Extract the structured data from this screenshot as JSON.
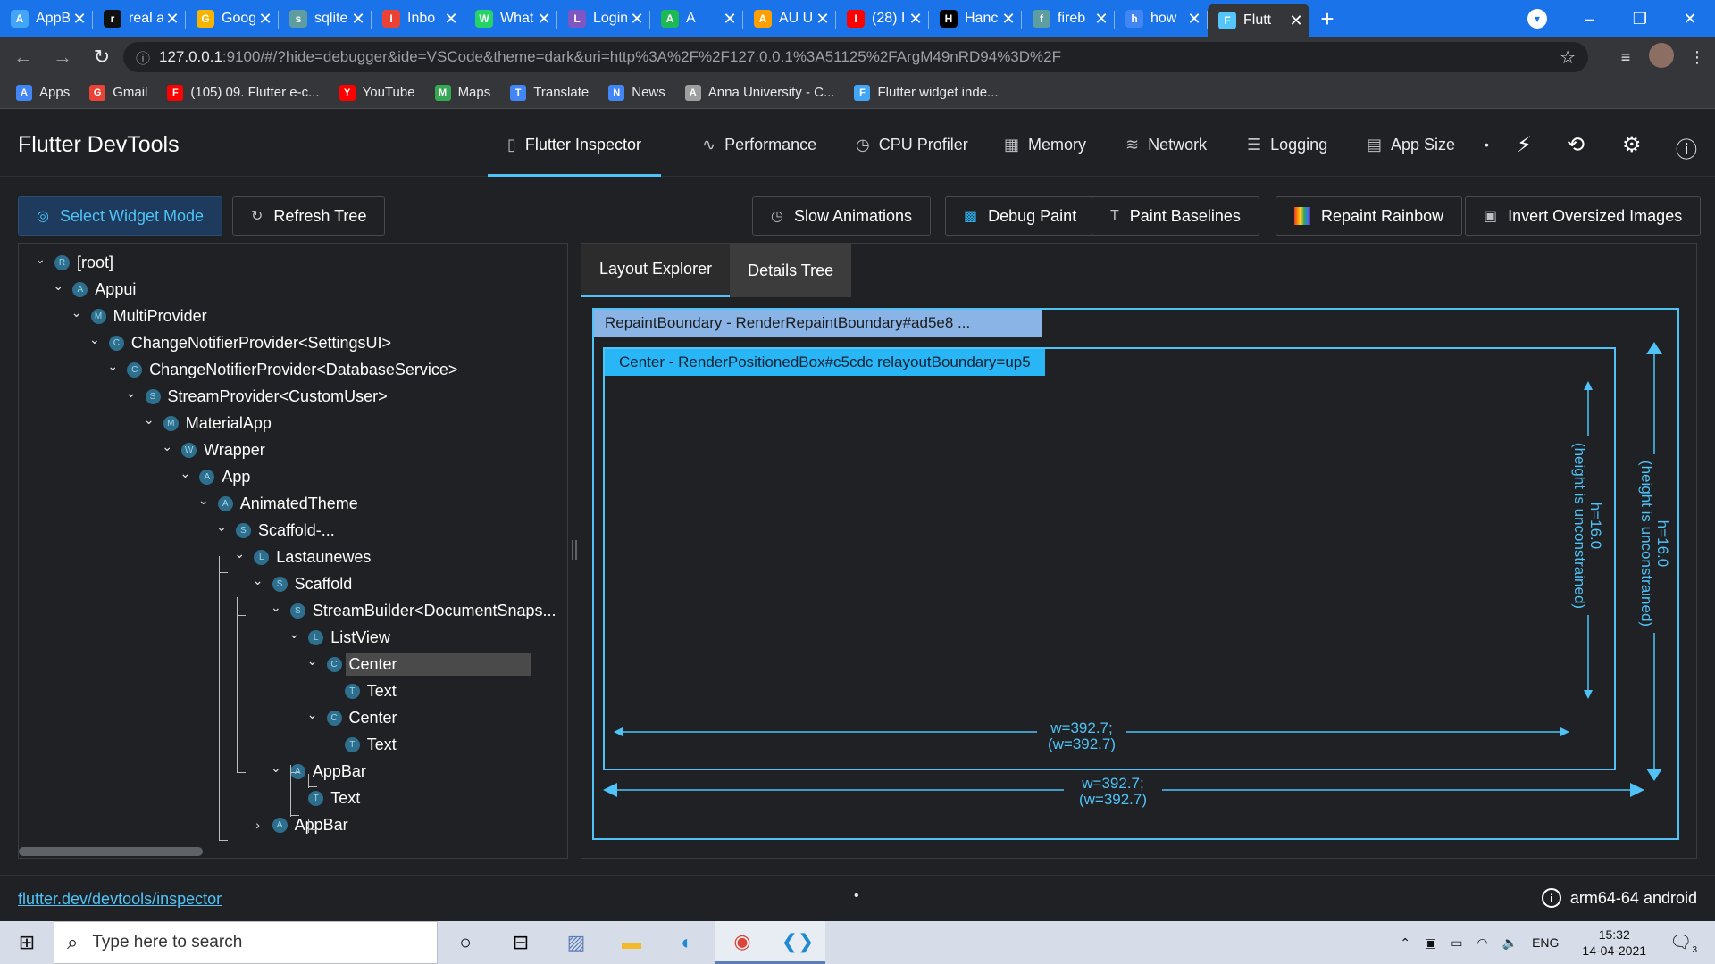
{
  "browser": {
    "tabs": [
      {
        "title": "AppB",
        "icon": "flutter-icon",
        "color": "#42a5f5"
      },
      {
        "title": "real a",
        "icon": "github-icon",
        "color": "#111111"
      },
      {
        "title": "Goog",
        "icon": "drive-icon",
        "color": "#f4b400"
      },
      {
        "title": "sqlite",
        "icon": "sqlite-icon",
        "color": "#5f9ea0"
      },
      {
        "title": "Inbo",
        "icon": "gmail-icon",
        "color": "#ea4335"
      },
      {
        "title": "What",
        "icon": "whatsapp-icon",
        "color": "#25d366"
      },
      {
        "title": "Login",
        "icon": "login-icon",
        "color": "#7e57c2"
      },
      {
        "title": "A",
        "icon": "spotify-icon",
        "color": "#1db954"
      },
      {
        "title": "AU U",
        "icon": "firebase-icon",
        "color": "#ffa000"
      },
      {
        "title": "(28) I",
        "icon": "youtube-icon",
        "color": "#ff0000"
      },
      {
        "title": "Hanc",
        "icon": "notion-icon",
        "color": "#000000"
      },
      {
        "title": "fireb",
        "icon": "firebase-docs-icon",
        "color": "#5f9ea0"
      },
      {
        "title": "how",
        "icon": "google-icon",
        "color": "#4285f4"
      },
      {
        "title": "Flutt",
        "icon": "flutter-devtools-icon",
        "color": "#54c5f8",
        "active": true
      }
    ],
    "url": {
      "host": "127.0.0.1",
      "rest": ":9100/#/?hide=debugger&ide=VSCode&theme=dark&uri=http%3A%2F%2F127.0.0.1%3A51125%2FArgM49nRD94%3D%2F"
    },
    "bookmarks": [
      {
        "label": "Apps",
        "icon": "apps-grid-icon",
        "color": "#4285f4"
      },
      {
        "label": "Gmail",
        "icon": "gmail-icon",
        "color": "#ea4335"
      },
      {
        "label": "(105) 09. Flutter e-c...",
        "icon": "youtube-icon",
        "color": "#ff0000"
      },
      {
        "label": "YouTube",
        "icon": "youtube-icon",
        "color": "#ff0000"
      },
      {
        "label": "Maps",
        "icon": "maps-icon",
        "color": "#34a853"
      },
      {
        "label": "Translate",
        "icon": "translate-icon",
        "color": "#4285f4"
      },
      {
        "label": "News",
        "icon": "news-icon",
        "color": "#4285f4"
      },
      {
        "label": "Anna University - C...",
        "icon": "university-icon",
        "color": "#9e9e9e"
      },
      {
        "label": "Flutter widget inde...",
        "icon": "flutter-icon",
        "color": "#42a5f5"
      }
    ]
  },
  "devtools": {
    "title": "Flutter DevTools",
    "nav": [
      {
        "label": "Flutter Inspector",
        "icon": "phone-icon",
        "active": true
      },
      {
        "label": "Performance",
        "icon": "pulse-icon"
      },
      {
        "label": "CPU Profiler",
        "icon": "timer-icon"
      },
      {
        "label": "Memory",
        "icon": "memory-icon"
      },
      {
        "label": "Network",
        "icon": "network-icon"
      },
      {
        "label": "Logging",
        "icon": "logging-icon"
      },
      {
        "label": "App Size",
        "icon": "app-size-icon"
      }
    ],
    "header_icons": [
      "lightning-icon",
      "hot-restart-icon",
      "settings-icon",
      "help-icon"
    ],
    "actions_left": [
      {
        "label": "Select Widget Mode",
        "icon": "target-icon",
        "selected": true
      },
      {
        "label": "Refresh Tree",
        "icon": "refresh-icon"
      }
    ],
    "actions_right": [
      {
        "label": "Slow Animations",
        "icon": "clock-icon"
      },
      {
        "label": "Debug Paint",
        "icon": "debug-paint-icon"
      },
      {
        "label": "Paint Baselines",
        "icon": "text-baseline-icon"
      },
      {
        "label": "Repaint Rainbow",
        "icon": "rainbow-icon"
      },
      {
        "label": "Invert Oversized Images",
        "icon": "image-icon"
      }
    ],
    "tree": [
      {
        "label": "[root]",
        "badge": "R",
        "depth": 0,
        "chevron": "down"
      },
      {
        "label": "Appui",
        "badge": "A",
        "depth": 1,
        "chevron": "down"
      },
      {
        "label": "MultiProvider",
        "badge": "M",
        "depth": 2,
        "chevron": "down"
      },
      {
        "label": "ChangeNotifierProvider<SettingsUI>",
        "badge": "C",
        "depth": 3,
        "chevron": "down"
      },
      {
        "label": "ChangeNotifierProvider<DatabaseService>",
        "badge": "C",
        "depth": 4,
        "chevron": "down"
      },
      {
        "label": "StreamProvider<CustomUser>",
        "badge": "S",
        "depth": 5,
        "chevron": "down"
      },
      {
        "label": "MaterialApp",
        "badge": "M",
        "depth": 6,
        "chevron": "down"
      },
      {
        "label": "Wrapper",
        "badge": "W",
        "depth": 7,
        "chevron": "down"
      },
      {
        "label": "App",
        "badge": "A",
        "depth": 8,
        "chevron": "down"
      },
      {
        "label": "AnimatedTheme",
        "badge": "A",
        "depth": 9,
        "chevron": "down"
      },
      {
        "label": "Scaffold-...",
        "badge": "S",
        "depth": 10,
        "chevron": "down"
      },
      {
        "label": "Lastaunewes",
        "badge": "L",
        "depth": 11,
        "chevron": "down"
      },
      {
        "label": "Scaffold",
        "badge": "S",
        "depth": 12,
        "chevron": "down"
      },
      {
        "label": "StreamBuilder<DocumentSnaps...",
        "badge": "S",
        "depth": 13,
        "chevron": "down"
      },
      {
        "label": "ListView",
        "badge": "L",
        "depth": 14,
        "chevron": "down"
      },
      {
        "label": "Center",
        "badge": "C",
        "depth": 15,
        "chevron": "down",
        "selected": true
      },
      {
        "label": "Text",
        "badge": "T",
        "depth": 16,
        "chevron": ""
      },
      {
        "label": "Center",
        "badge": "C",
        "depth": 15,
        "chevron": "down"
      },
      {
        "label": "Text",
        "badge": "T",
        "depth": 16,
        "chevron": ""
      },
      {
        "label": "AppBar",
        "badge": "A",
        "depth": 13,
        "chevron": "down"
      },
      {
        "label": "Text",
        "badge": "T",
        "depth": 14,
        "chevron": ""
      },
      {
        "label": "AppBar",
        "badge": "A",
        "depth": 12,
        "chevron": "right"
      }
    ],
    "panel_tabs": [
      {
        "label": "Layout Explorer",
        "active": true
      },
      {
        "label": "Details Tree"
      }
    ],
    "layout": {
      "outer_label": "RepaintBoundary - RenderRepaintBoundary#ad5e8 ...",
      "inner_label": "Center - RenderPositionedBox#c5cdc relayoutBoundary=up5",
      "inner_height": "h=16.0",
      "inner_height_note": "(height is unconstrained)",
      "inner_width": "w=392.7;",
      "inner_width_note": "(w=392.7)",
      "outer_height": "h=16.0",
      "outer_height_note": "(height is unconstrained)",
      "outer_width": "w=392.7;",
      "outer_width_note": "(w=392.7)"
    },
    "footer": {
      "link": "flutter.dev/devtools/inspector",
      "dot": "•",
      "device": "arm64-64 android"
    }
  },
  "taskbar": {
    "search_placeholder": "Type here to search",
    "apps": [
      "task-view-icon",
      "multitask-icon",
      "photos-icon",
      "file-explorer-icon",
      "edge-icon",
      "chrome-icon",
      "vscode-icon"
    ],
    "lang": "ENG",
    "time": "15:32",
    "date": "14-04-2021",
    "notif_count": "3"
  }
}
